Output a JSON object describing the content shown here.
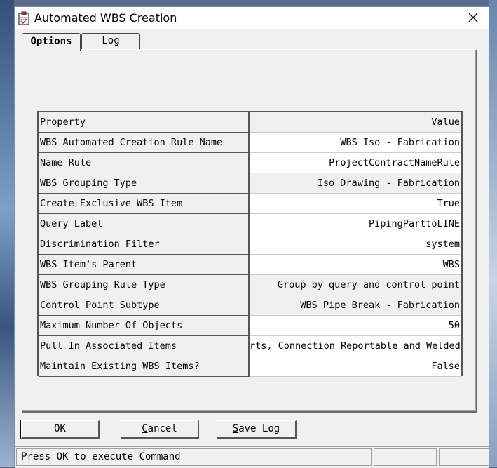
{
  "window": {
    "title": "Automated WBS Creation"
  },
  "tabs": [
    {
      "label": "Options",
      "active": true
    },
    {
      "label": "Log",
      "active": false
    }
  ],
  "grid": {
    "header": {
      "property": "Property",
      "value": "Value"
    },
    "rows": [
      {
        "property": "WBS Automated Creation Rule Name",
        "value": "WBS Iso - Fabrication"
      },
      {
        "property": "Name Rule",
        "value": "ProjectContractNameRule"
      },
      {
        "property": "WBS Grouping Type",
        "value": "Iso Drawing - Fabrication"
      },
      {
        "property": "Create Exclusive WBS Item",
        "value": "True"
      },
      {
        "property": "Query Label",
        "value": "PipingParttoLINE"
      },
      {
        "property": "Discrimination Filter",
        "value": "system"
      },
      {
        "property": "WBS Item's Parent",
        "value": "WBS"
      },
      {
        "property": "WBS Grouping Rule Type",
        "value": "Group by query and control point"
      },
      {
        "property": "Control Point Subtype",
        "value": "WBS Pipe Break - Fabrication"
      },
      {
        "property": "Maximum Number Of Objects",
        "value": "50"
      },
      {
        "property": "Pull In Associated Items",
        "value": "rts, Connection Reportable and Welded"
      },
      {
        "property": "Maintain Existing WBS Items?",
        "value": "False"
      }
    ]
  },
  "buttons": {
    "ok": {
      "mnemonic": "",
      "rest": "OK"
    },
    "cancel": {
      "mnemonic": "C",
      "rest": "ancel"
    },
    "save_log": {
      "mnemonic": "S",
      "rest": "ave Log"
    }
  },
  "status": {
    "text": "Press OK to execute Command"
  },
  "icons": {
    "app": "clipboard-check-icon",
    "close": "close-icon"
  }
}
